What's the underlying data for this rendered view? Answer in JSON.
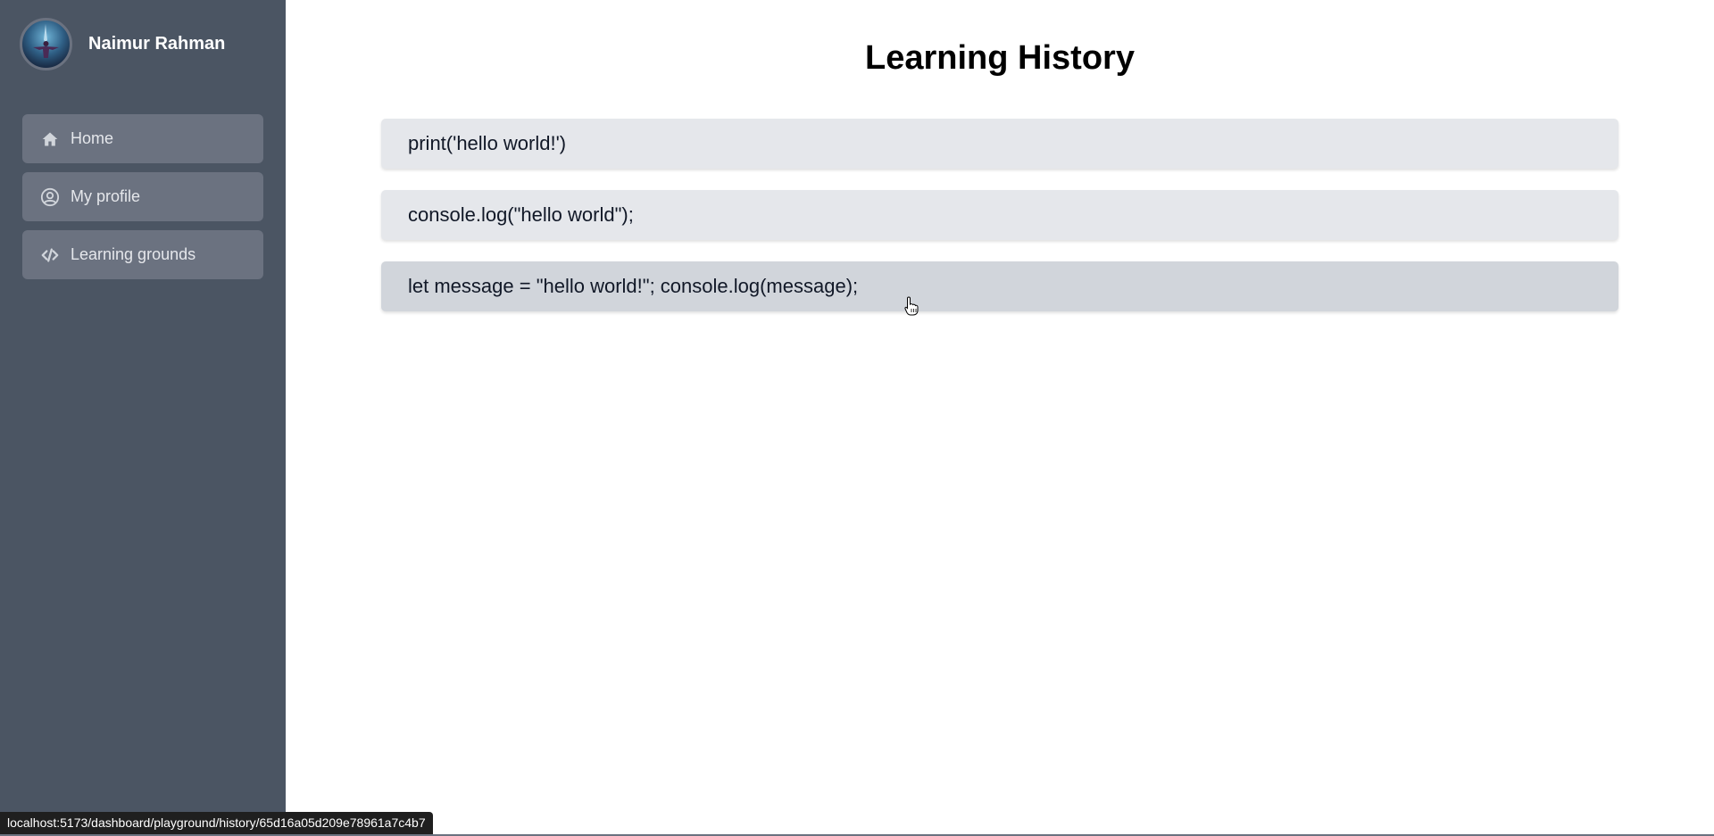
{
  "sidebar": {
    "user_name": "Naimur Rahman",
    "items": [
      {
        "label": "Home",
        "icon": "home-icon"
      },
      {
        "label": "My profile",
        "icon": "user-circle-icon"
      },
      {
        "label": "Learning grounds",
        "icon": "code-icon"
      }
    ]
  },
  "main": {
    "title": "Learning History",
    "history": [
      "print('hello world!')",
      "console.log(\"hello world\");",
      "let message = \"hello world!\"; console.log(message);"
    ]
  },
  "status_bar": {
    "url": "localhost:5173/dashboard/playground/history/65d16a05d209e78961a7c4b7"
  },
  "colors": {
    "sidebar_bg": "#4b5563",
    "nav_item_bg": "#6b7280",
    "history_item_bg": "#e5e7eb",
    "history_item_hover_bg": "#d1d5db"
  }
}
